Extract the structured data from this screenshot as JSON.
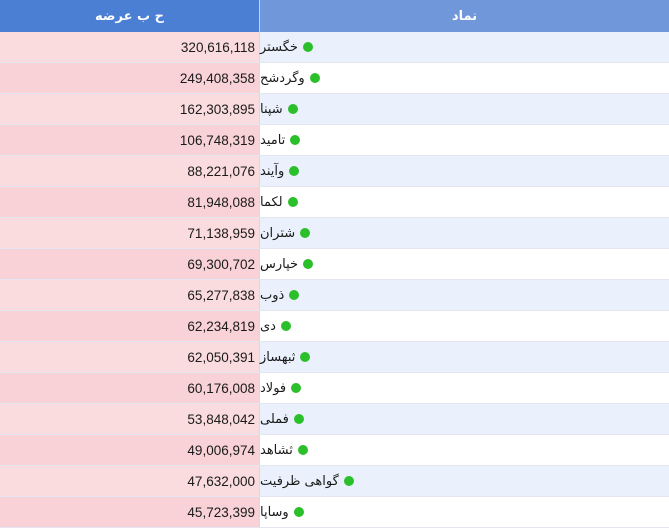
{
  "table": {
    "headers": {
      "volume": "ح ب عرضه",
      "symbol": "نماد"
    },
    "status_color": "#2bbf2b",
    "rows": [
      {
        "symbol": "خگستر",
        "volume": "320,616,118"
      },
      {
        "symbol": "وگردشح",
        "volume": "249,408,358"
      },
      {
        "symbol": "شپنا",
        "volume": "162,303,895"
      },
      {
        "symbol": "تامید",
        "volume": "106,748,319"
      },
      {
        "symbol": "وآیند",
        "volume": "88,221,076"
      },
      {
        "symbol": "لکما",
        "volume": "81,948,088"
      },
      {
        "symbol": "شتران",
        "volume": "71,138,959"
      },
      {
        "symbol": "خپارس",
        "volume": "69,300,702"
      },
      {
        "symbol": "ذوب",
        "volume": "65,277,838"
      },
      {
        "symbol": "دی",
        "volume": "62,234,819"
      },
      {
        "symbol": "ثبهساز",
        "volume": "62,050,391"
      },
      {
        "symbol": "فولاد",
        "volume": "60,176,008"
      },
      {
        "symbol": "فملی",
        "volume": "53,848,042"
      },
      {
        "symbol": "ثشاهد",
        "volume": "49,006,974"
      },
      {
        "symbol": "گواهی ظرفیت",
        "volume": "47,632,000"
      },
      {
        "symbol": "وساپا",
        "volume": "45,723,399"
      }
    ]
  }
}
